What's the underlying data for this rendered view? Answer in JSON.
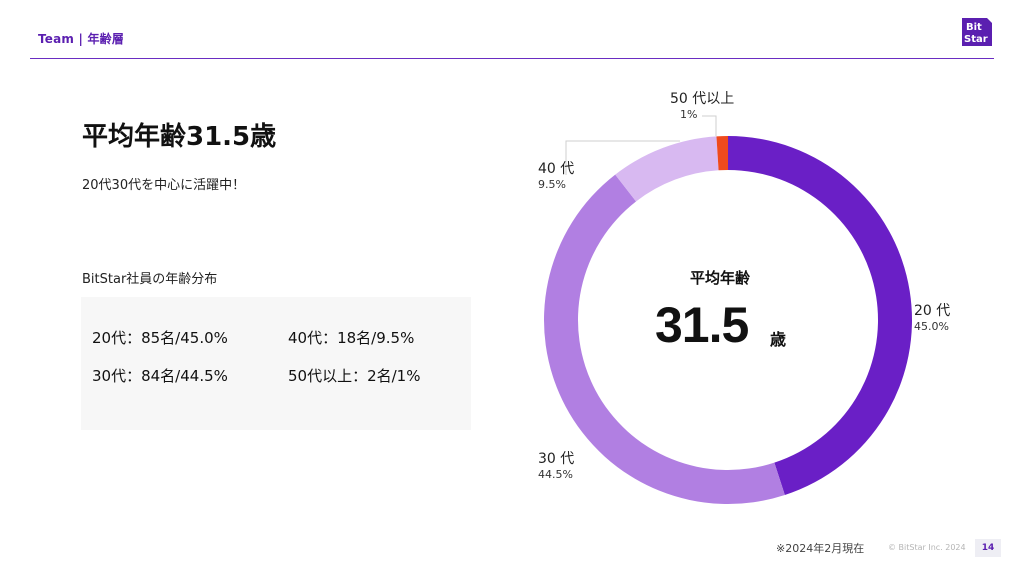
{
  "header": {
    "section": "Team | 年齢層",
    "logo_text": "Bit Star"
  },
  "main": {
    "title": "平均年齢31.5歳",
    "subtitle": "20代30代を中心に活躍中！",
    "distribution_heading": "BitStar社員の年齢分布",
    "distribution": [
      "20代：85名/45.0%",
      "40代：18名/9.5%",
      "30代：84名/44.5%",
      "50代以上：2名/1%"
    ]
  },
  "donut": {
    "center_label": "平均年齢",
    "center_value": "31.5",
    "center_unit": "歳"
  },
  "chart_data": {
    "type": "pie",
    "categories": [
      "20 代",
      "30 代",
      "40 代",
      "50 代以上"
    ],
    "values": [
      45.0,
      44.5,
      9.5,
      1
    ],
    "value_labels": [
      "45.0%",
      "44.5%",
      "9.5%",
      "1%"
    ],
    "colors": [
      "#6a1fc6",
      "#b17fe2",
      "#d8b9f1",
      "#ef4a1c"
    ],
    "donut": true
  },
  "footer": {
    "note": "※2024年2月現在",
    "copyright": "© BitStar Inc. 2024",
    "page": "14"
  },
  "colors": {
    "accent": "#5b1fb0",
    "rule": "#6a2dc2"
  }
}
